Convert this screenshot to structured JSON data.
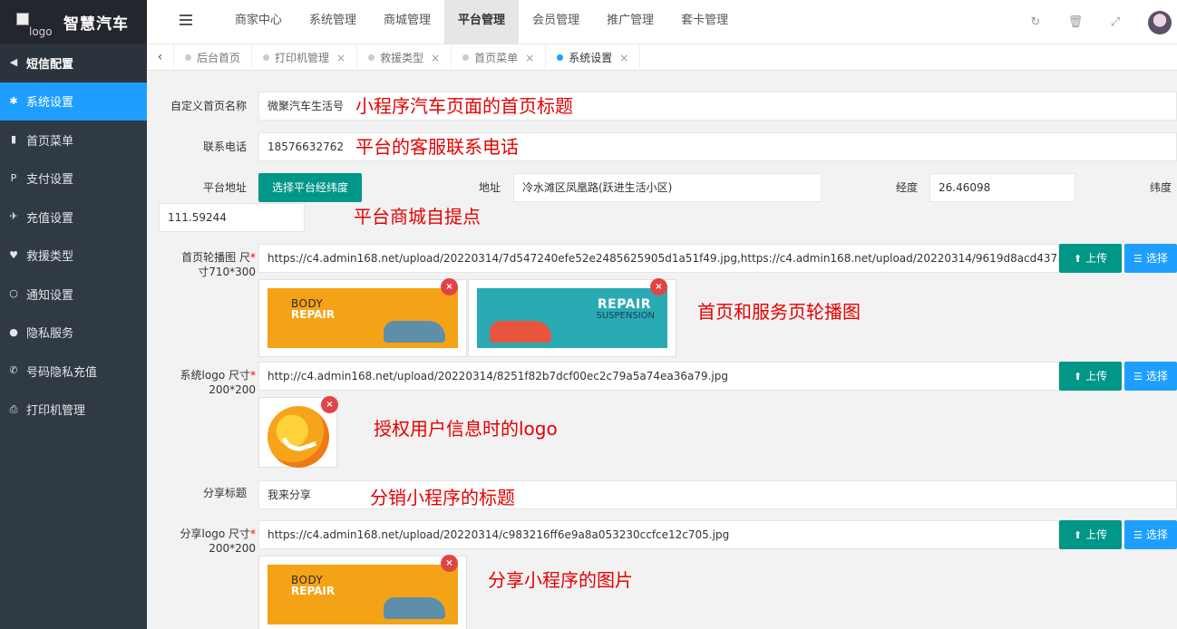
{
  "app": {
    "logo_alt": "logo",
    "title": "智慧汽车"
  },
  "sidebar": {
    "items": [
      {
        "label": "短信配置",
        "icon": "megaphone-icon"
      },
      {
        "label": "系统设置",
        "icon": "gear-icon"
      },
      {
        "label": "首页菜单",
        "icon": "bookmark-icon"
      },
      {
        "label": "支付设置",
        "icon": "paypal-icon"
      },
      {
        "label": "充值设置",
        "icon": "ticket-icon"
      },
      {
        "label": "救援类型",
        "icon": "heart-icon"
      },
      {
        "label": "通知设置",
        "icon": "circle-icon"
      },
      {
        "label": "隐私服务",
        "icon": "p-circle-icon"
      },
      {
        "label": "号码隐私充值",
        "icon": "phone-icon"
      },
      {
        "label": "打印机管理",
        "icon": "printer-icon"
      }
    ],
    "active_index": 1
  },
  "topnav": {
    "items": [
      "商家中心",
      "系统管理",
      "商城管理",
      "平台管理",
      "会员管理",
      "推广管理",
      "套卡管理"
    ],
    "active_index": 3
  },
  "tabs": {
    "items": [
      {
        "label": "后台首页",
        "closable": false
      },
      {
        "label": "打印机管理",
        "closable": true
      },
      {
        "label": "救援类型",
        "closable": true
      },
      {
        "label": "首页菜单",
        "closable": true
      },
      {
        "label": "系统设置",
        "closable": true
      }
    ],
    "active_index": 4,
    "close_glyph": "×",
    "back_glyph": "‹"
  },
  "form": {
    "home_title": {
      "label": "自定义首页名称",
      "value": "微聚汽车生活号",
      "note": "小程序汽车页面的首页标题"
    },
    "phone": {
      "label": "联系电话",
      "value": "18576632762",
      "note": "平台的客服联系电话"
    },
    "address": {
      "label": "平台地址",
      "pick_button": "选择平台经纬度",
      "addr_label": "地址",
      "addr_value": "冷水滩区凤凰路(跃进生活小区)",
      "lng_label": "经度",
      "lng_value": "26.46098",
      "lat_label": "纬度",
      "lat_value": "111.59244",
      "note": "平台商城自提点"
    },
    "carousel": {
      "label_line1": "首页轮播图 尺",
      "label_line2": "寸710*300",
      "required": "*",
      "value": "https://c4.admin168.net/upload/20220314/7d547240efe52e2485625905d1a51f49.jpg,https://c4.admin168.net/upload/20220314/9619d8acd4374dbd6497d2e7007281",
      "note": "首页和服务页轮播图",
      "banners": [
        {
          "line1": "BODY",
          "line2": "REPAIR"
        },
        {
          "line1": "REPAIR",
          "line2": "SUSPENSION"
        }
      ]
    },
    "syslogo": {
      "label_line1": "系统logo 尺寸",
      "label_line2": "200*200",
      "required": "*",
      "value": "http://c4.admin168.net/upload/20220314/8251f82b7dcf00ec2c79a5a74ea36a79.jpg",
      "note": "授权用户信息时的logo"
    },
    "share_title": {
      "label": "分享标题",
      "value": "我来分享",
      "note": "分销小程序的标题"
    },
    "share_logo": {
      "label_line1": "分享logo 尺寸",
      "label_line2": "200*200",
      "required": "*",
      "value": "https://c4.admin168.net/upload/20220314/c983216ff6e9a8a053230ccfce12c705.jpg",
      "note": "分享小程序的图片",
      "banner": {
        "line1": "BODY",
        "line2": "REPAIR"
      }
    },
    "upload_label": "上传",
    "select_label": "选择",
    "thumb_close": "×"
  },
  "colors": {
    "accent_blue": "#1e9fff",
    "teal": "#009688",
    "sidebar_bg": "#2f3a45",
    "note_red": "#e60000"
  }
}
